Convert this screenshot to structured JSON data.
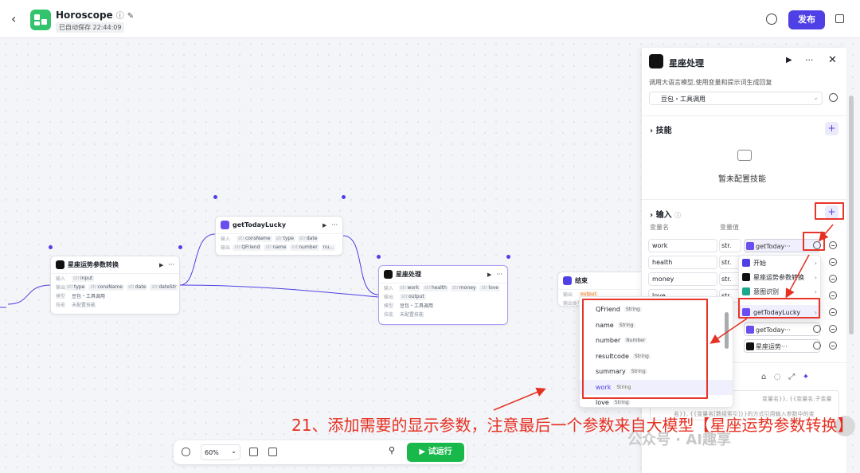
{
  "header": {
    "title": "Horoscope",
    "autosave": "已自动保存 22:44:09",
    "publish": "发布"
  },
  "nodes": {
    "n1": {
      "title": "星座运势参数转换",
      "in_k": "输入",
      "in": "input",
      "out_k": "输出",
      "outs": [
        "type",
        "consName",
        "date",
        "dateStr"
      ],
      "model_k": "模型",
      "model": "豆包・工具调用",
      "skill_k": "技能",
      "skill": "未配置技能"
    },
    "n2": {
      "title": "getTodayLucky",
      "in_k": "输入",
      "ins": [
        "consName",
        "type",
        "date"
      ],
      "out_k": "输出",
      "outs": [
        "QFriend",
        "name",
        "number",
        "nu..."
      ]
    },
    "n3": {
      "title": "星座处理",
      "in_k": "输入",
      "ins": [
        "work",
        "health",
        "money",
        "love"
      ],
      "out_k": "输出",
      "out": "output",
      "model_k": "模型",
      "model": "豆包・工具调用",
      "skill_k": "技能",
      "skill": "未配置技能"
    },
    "n4": {
      "title": "结束",
      "out_k": "输出",
      "out": "output",
      "mode_k": "输出类型"
    }
  },
  "panel": {
    "title": "星座处理",
    "desc": "调用大语言模型,使用变量和提示词生成回复",
    "model": "豆包・工具调用",
    "skills_label": "技能",
    "skills_empty": "暂未配置技能",
    "input_label": "输入",
    "col_name": "变量名",
    "col_value": "变量值",
    "rows": [
      {
        "name": "work",
        "type": "str.",
        "value": "getToday···"
      },
      {
        "name": "health",
        "type": "str."
      },
      {
        "name": "money",
        "type": "str."
      },
      {
        "name": "love",
        "type": "str."
      },
      {
        "name": "",
        "type": "str."
      },
      {
        "name": "",
        "type": "str.",
        "value": "getToday···"
      },
      {
        "name": "",
        "type": "str.",
        "value": "星座运势···"
      }
    ],
    "prompt_hint": "变量名}}, {{变量名.子变量",
    "prompt_hint2": "名}}, {{变量名[数组索引]}}的方式引用输入参数中的变"
  },
  "menu": {
    "items": [
      {
        "label": "开始",
        "color": "#4e40e5"
      },
      {
        "label": "星座运势参数转换",
        "color": "#111111"
      },
      {
        "label": "意图识别",
        "color": "#1aa98a"
      },
      {
        "label": "getTodayLucky",
        "color": "#6b4ef0"
      }
    ]
  },
  "submenu": {
    "items": [
      {
        "name": "QFriend",
        "type": "String"
      },
      {
        "name": "name",
        "type": "String"
      },
      {
        "name": "number",
        "type": "Number"
      },
      {
        "name": "resultcode",
        "type": "String"
      },
      {
        "name": "summary",
        "type": "String"
      },
      {
        "name": "work",
        "type": "String"
      },
      {
        "name": "love",
        "type": "String"
      }
    ]
  },
  "bottombar": {
    "zoom": "60%",
    "run": "试运行"
  },
  "annotation": "21、添加需要的显示参数，注意最后一个参数来自大模型【星座运势参数转换】",
  "watermark": "公众号 · AI趣享"
}
